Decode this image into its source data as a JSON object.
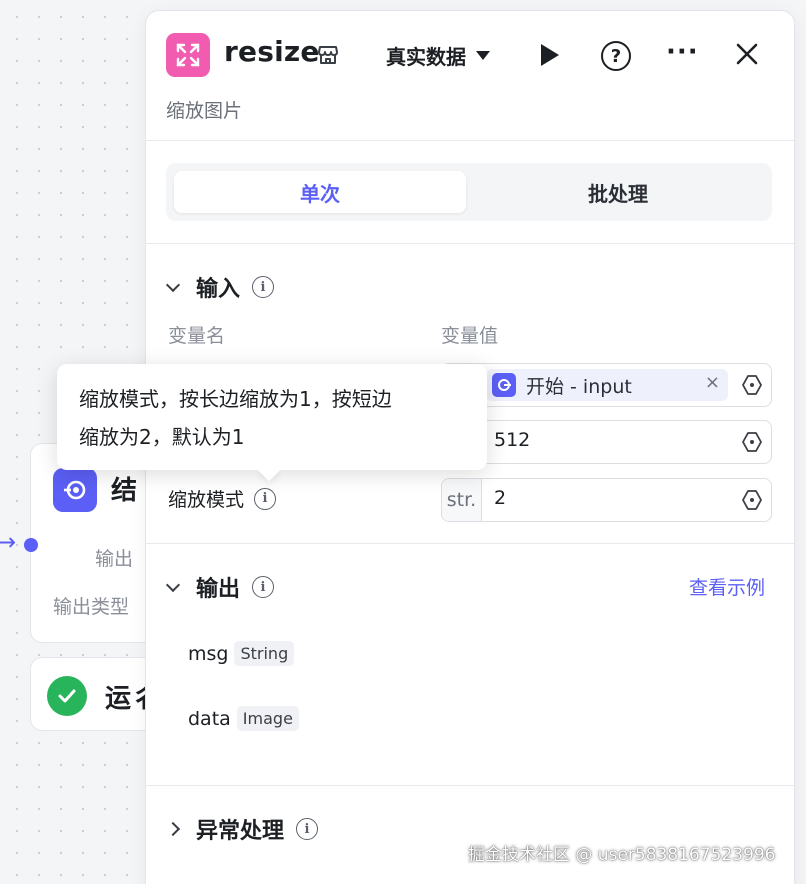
{
  "canvas": {
    "end_node": {
      "title": "结",
      "output_label": "输出",
      "output_type_label": "输出类型"
    },
    "run_node": {
      "title": "运彳"
    }
  },
  "panel": {
    "title": "resize",
    "subtitle": "缩放图片",
    "data_mode": "真实数据",
    "tabs": [
      {
        "label": "单次",
        "active": true
      },
      {
        "label": "批处理",
        "active": false
      }
    ],
    "input": {
      "section_title": "输入",
      "col_name": "变量名",
      "col_value": "变量值",
      "rows": [
        {
          "ref": "开始 - input",
          "remove": "×"
        },
        {
          "value": "512"
        },
        {
          "name": "缩放模式",
          "type": "str.",
          "value": "2"
        }
      ]
    },
    "output": {
      "section_title": "输出",
      "example_link": "查看示例",
      "fields": [
        {
          "name": "msg",
          "type": "String"
        },
        {
          "name": "data",
          "type": "Image"
        }
      ]
    },
    "error": {
      "section_title": "异常处理"
    }
  },
  "tooltip": {
    "line1": "缩放模式，按长边缩放为1，按短边",
    "line2": "缩放为2，默认为1"
  },
  "watermark": "掘金技术社区 @ user5838167523996",
  "colors": {
    "accent": "#5b5ff5",
    "app_icon": "#f25cb0",
    "success": "#27b45a"
  },
  "icons": [
    "expand-icon",
    "store-icon",
    "play-icon",
    "help-icon",
    "more-icon",
    "close-icon",
    "info-icon",
    "chevron-down-icon",
    "chevron-right-icon",
    "variable-icon",
    "start-node-icon",
    "end-node-icon",
    "check-icon"
  ]
}
